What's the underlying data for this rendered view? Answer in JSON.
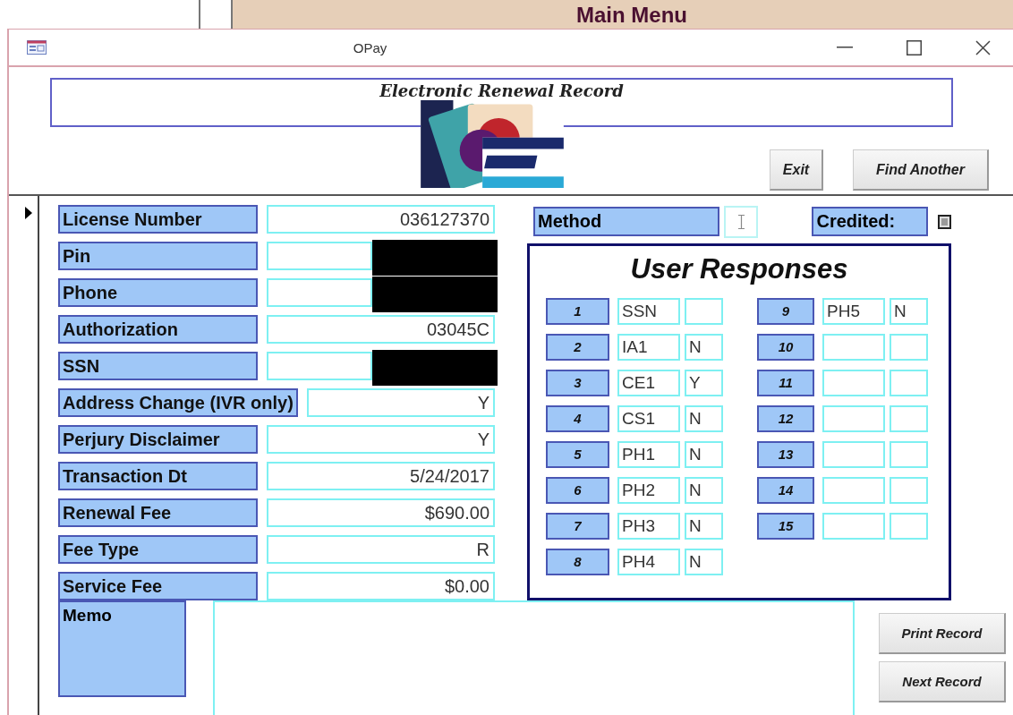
{
  "background_window": {
    "title": "Main Menu"
  },
  "window": {
    "title": "OPay"
  },
  "header": {
    "title": "Electronic Renewal Record",
    "buttons": [
      {
        "label": "Exit"
      },
      {
        "label": "Find Another"
      }
    ]
  },
  "fields": [
    {
      "label": "License Number",
      "value": "036127370"
    },
    {
      "label": "Pin",
      "redacted": true
    },
    {
      "label": "Phone",
      "redacted": true
    },
    {
      "label": "Authorization",
      "value": "03045C"
    },
    {
      "label": "SSN",
      "redacted": true
    },
    {
      "label": "Address Change (IVR only)",
      "value": "Y"
    },
    {
      "label": "Perjury Disclaimer",
      "value": "Y"
    },
    {
      "label": "Transaction Dt",
      "value": "5/24/2017"
    },
    {
      "label": "Renewal Fee",
      "value": "$690.00"
    },
    {
      "label": "Fee Type",
      "value": "R"
    },
    {
      "label": "Service Fee",
      "value": "$0.00"
    }
  ],
  "method": {
    "label": "Method"
  },
  "credited": {
    "label": "Credited:",
    "checked": true
  },
  "user_responses": {
    "title": "User Responses",
    "rows": [
      {
        "number": "1",
        "code": "SSN"
      },
      {
        "number": "2",
        "code": "IA1",
        "answer": "N"
      },
      {
        "number": "3",
        "code": "CE1",
        "answer": "Y"
      },
      {
        "number": "4",
        "code": "CS1",
        "answer": "N"
      },
      {
        "number": "5",
        "code": "PH1",
        "answer": "N"
      },
      {
        "number": "6",
        "code": "PH2",
        "answer": "N"
      },
      {
        "number": "7",
        "code": "PH3",
        "answer": "N"
      },
      {
        "number": "8",
        "code": "PH4",
        "answer": "N"
      },
      {
        "number": "9",
        "code": "PH5",
        "answer": "N"
      },
      {
        "number": "10"
      },
      {
        "number": "11"
      },
      {
        "number": "12"
      },
      {
        "number": "13"
      },
      {
        "number": "14"
      },
      {
        "number": "15"
      }
    ]
  },
  "memo": {
    "label": "Memo"
  },
  "footer_buttons": [
    {
      "label": "Print Record"
    },
    {
      "label": "Next Record"
    }
  ]
}
